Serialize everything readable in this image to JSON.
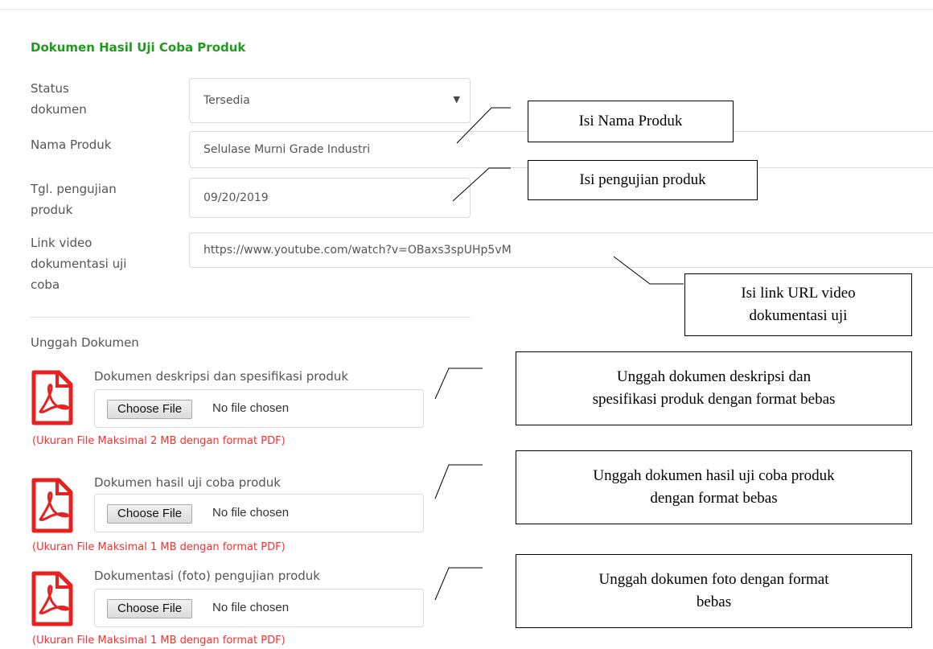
{
  "section": {
    "title": "Dokumen Hasil Uji Coba Produk"
  },
  "form": {
    "status": {
      "label_line1": "Status",
      "label_line2": "dokumen",
      "value": "Tersedia"
    },
    "nama_produk": {
      "label": "Nama Produk",
      "value": "Selulase Murni Grade Industri"
    },
    "tgl": {
      "label_line1": "Tgl. pengujian",
      "label_line2": "produk",
      "value": "09/20/2019"
    },
    "link": {
      "label_line1": "Link video",
      "label_line2": "dokumentasi uji",
      "label_line3": "coba",
      "value": "https://www.youtube.com/watch?v=OBaxs3spUHp5vM"
    }
  },
  "upload": {
    "title": "Unggah Dokumen",
    "items": [
      {
        "label": "Dokumen deskripsi dan spesifikasi produk",
        "button": "Choose File",
        "status": "No file chosen",
        "hint": "(Ukuran File Maksimal 2 MB dengan format PDF)",
        "icon": "pdf-icon"
      },
      {
        "label": "Dokumen hasil uji coba produk",
        "button": "Choose File",
        "status": "No file chosen",
        "hint": "(Ukuran File Maksimal 1 MB dengan format PDF)",
        "icon": "pdf-icon"
      },
      {
        "label": "Dokumentasi (foto) pengujian produk",
        "button": "Choose File",
        "status": "No file chosen",
        "hint": "(Ukuran File Maksimal 1 MB dengan format PDF)",
        "icon": "pdf-icon"
      }
    ]
  },
  "callouts": {
    "nama": "Isi Nama Produk",
    "pengujian": "Isi pengujian produk",
    "link_line1": "Isi link URL video",
    "link_line2": "dokumentasi uji",
    "doc1_line1": "Unggah dokumen deskripsi dan",
    "doc1_line2": "spesifikasi produk dengan format bebas",
    "doc2_line1": "Unggah dokumen hasil uji coba produk",
    "doc2_line2": "dengan format bebas",
    "doc3_line1": "Unggah dokumen foto dengan format",
    "doc3_line2": "bebas"
  },
  "colors": {
    "section_title": "#1f9a1f",
    "hint_red": "#ff2d2d",
    "pdf_red": "#e8201f"
  }
}
